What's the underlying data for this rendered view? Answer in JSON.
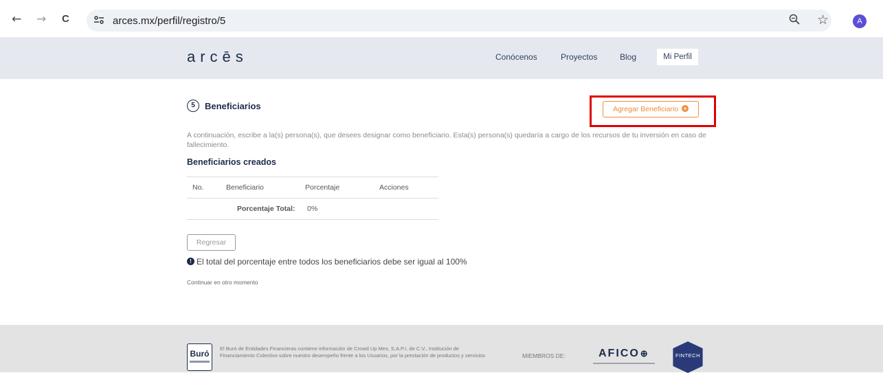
{
  "browser": {
    "back": "←",
    "forward": "→",
    "reload": "C",
    "url": "arces.mx/perfil/registro/5",
    "avatar_letter": "A"
  },
  "header": {
    "logo": "arcēs",
    "nav": [
      "Conócenos",
      "Proyectos",
      "Blog",
      "Mi Perfil"
    ]
  },
  "step": {
    "number": "5",
    "title": "Beneficiarios",
    "add_button": "Agregar Beneficiario",
    "description": "A continuación, escribe a la(s) persona(s), que desees designar como beneficiario. Esta(s) persona(s) quedaría a cargo de los recursos de tu inversión en caso de fallecimiento.",
    "created_title": "Beneficiarios creados"
  },
  "table": {
    "headers": [
      "No.",
      "Beneficiario",
      "Porcentaje",
      "Acciones"
    ],
    "total_label": "Porcentaje Total:",
    "total_value": "0%"
  },
  "actions": {
    "back": "Regresar",
    "info": "El total del porcentaje entre todos los beneficiarios debe ser igual al 100%",
    "continue_later": "Continuar en otro momento"
  },
  "footer": {
    "buro": "Buró",
    "text": "El Buró de Entidades Financieras contiene información de Crowd Up Mex, S.A.P.I. de C.V., Institución de Financiamiento Colectivo sobre nuestro desempeño frente a los Usuarios, por la prestación de productos y servicios",
    "members_label": "MIEMBROS DE:",
    "afico": "AFICO",
    "fintech": "FINTECH"
  },
  "colors": {
    "accent": "#f08c37",
    "highlight": "#e00000",
    "primary": "#1c2b4a"
  }
}
